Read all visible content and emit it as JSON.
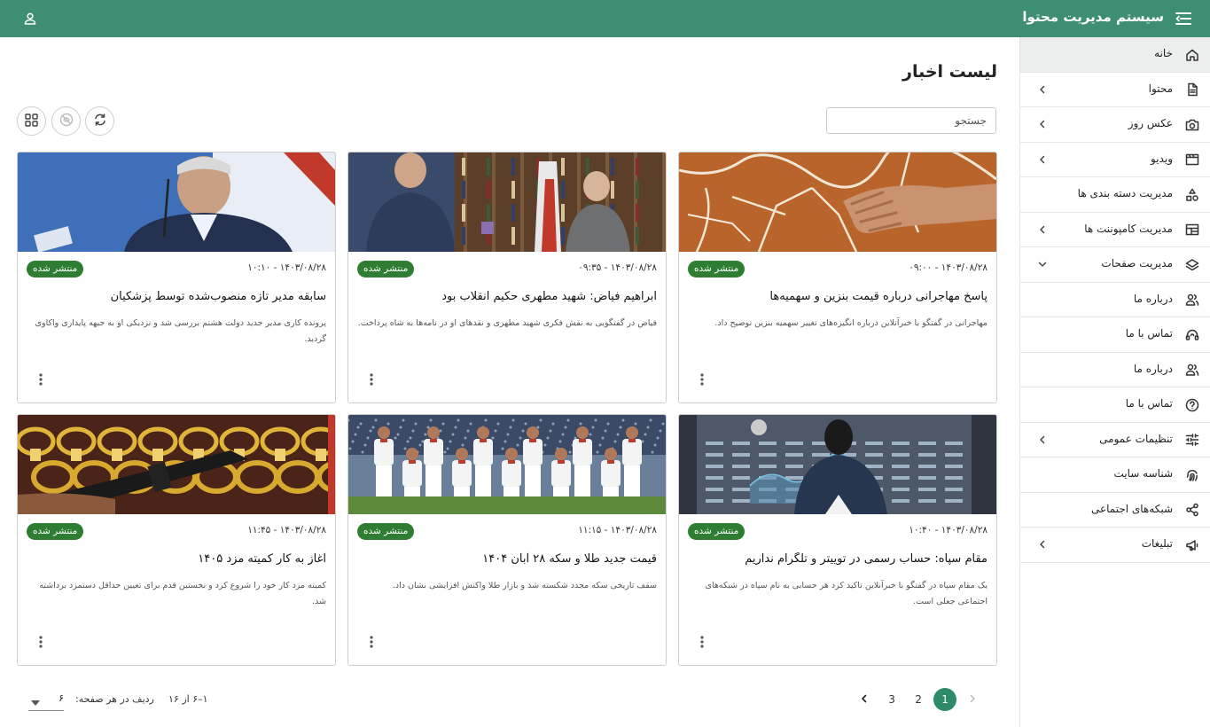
{
  "app": {
    "title": "سیستم مدیریت محتوا",
    "accent": "#3e8e74",
    "menu_icon": "menu-icon",
    "user_icon": "user-icon"
  },
  "sidebar": {
    "items": [
      {
        "label": "خانه",
        "icon": "home-icon",
        "chevron": "",
        "active": true
      },
      {
        "label": "محتوا",
        "icon": "document-icon",
        "chevron": "left"
      },
      {
        "label": "عکس روز",
        "icon": "camera-icon",
        "chevron": "left"
      },
      {
        "label": "ویدیو",
        "icon": "video-icon",
        "chevron": "left"
      },
      {
        "label": "مدیریت دسته بندی ها",
        "icon": "category-icon",
        "chevron": ""
      },
      {
        "label": "مدیریت کامپوننت ها",
        "icon": "layout-icon",
        "chevron": "left"
      },
      {
        "label": "مدیریت صفحات",
        "icon": "layers-icon",
        "chevron": "down"
      },
      {
        "label": "درباره ما",
        "icon": "people-icon",
        "chevron": ""
      },
      {
        "label": "تماس با ما",
        "icon": "headset-icon",
        "chevron": ""
      },
      {
        "label": "درباره ما",
        "icon": "people-icon",
        "chevron": ""
      },
      {
        "label": "تماس با ما",
        "icon": "help-icon",
        "chevron": ""
      },
      {
        "label": "تنظیمات عمومی",
        "icon": "sliders-icon",
        "chevron": "left"
      },
      {
        "label": "شناسه سایت",
        "icon": "fingerprint-icon",
        "chevron": ""
      },
      {
        "label": "شبکه‌های اجتماعی",
        "icon": "share-icon",
        "chevron": ""
      },
      {
        "label": "تبلیغات",
        "icon": "megaphone-icon",
        "chevron": "left"
      }
    ]
  },
  "main": {
    "page_title": "لیست اخبار",
    "search_placeholder": "جستجو",
    "toolbar_icons": [
      "refresh-icon",
      "hide-icon",
      "grid-view-icon"
    ]
  },
  "cards": [
    {
      "status": "منتشر شده",
      "date": "۱۴۰۳/۰۸/۲۸ - ۰۹:۰۰",
      "title": "پاسخ مهاجرانی درباره قیمت بنزین و سهمیه‌ها",
      "desc": "مهاجرانی در گفتگو با خبرآنلاین درباره انگیزه‌های تغییر سهمیه بنزین توضیح داد.",
      "image": "cracked-earth-photo"
    },
    {
      "status": "منتشر شده",
      "date": "۱۴۰۳/۰۸/۲۸ - ۰۹:۳۵",
      "title": "ابراهیم فیاض: شهید مطهری حکیم انقلاب بود",
      "desc": "فیاض در گفتگویی به نقش فکری شهید مطهری و نقدهای او در نامه‌ها به شاه پرداخت.",
      "image": "interview-photo"
    },
    {
      "status": "منتشر شده",
      "date": "۱۴۰۳/۰۸/۲۸ - ۱۰:۱۰",
      "title": "سابقه مدیر تازه منصوب‌شده توسط پزشکیان",
      "desc": "پرونده کاری مدیر جدید دولت هشتم بررسی شد و نزدیکی او به جبهه پایداری واکاوی گردید.",
      "image": "speaker-photo"
    },
    {
      "status": "منتشر شده",
      "date": "۱۴۰۳/۰۸/۲۸ - ۱۰:۴۰",
      "title": "مقام سپاه: حساب رسمی در توییتر و تلگرام نداریم",
      "desc": "یک مقام سپاه در گفتگو با خبرآنلاین تاکید کرد هر حسابی به نام سپاه در شبکه‌های اجتماعی جعلی است.",
      "image": "stock-exchange-photo"
    },
    {
      "status": "منتشر شده",
      "date": "۱۴۰۳/۰۸/۲۸ - ۱۱:۱۵",
      "title": "قیمت جدید طلا و سکه ۲۸ آبان ۱۴۰۴",
      "desc": "سقف تاریخی سکه مجدد شکسته شد و بازار طلا واکنش افزایشی نشان داد.",
      "image": "football-team-photo"
    },
    {
      "status": "منتشر شده",
      "date": "۱۴۰۳/۰۸/۲۸ - ۱۱:۴۵",
      "title": "آغاز به کار کمیته مزد ۱۴۰۵",
      "desc": "کمیته مزد کار خود را شروع کرد و نخستین قدم برای تعیین حداقل دستمزد برداشته شد.",
      "image": "gold-jewelry-photo"
    }
  ],
  "pagination": {
    "pages": [
      "1",
      "2",
      "3"
    ],
    "current": "1",
    "rows_label": "ردیف در هر صفحه:",
    "rows_value": "۶",
    "range": "۱–۶ از ۱۶"
  },
  "colors": {
    "badge": "#2e7d32",
    "page_active": "#2e8b6a"
  }
}
